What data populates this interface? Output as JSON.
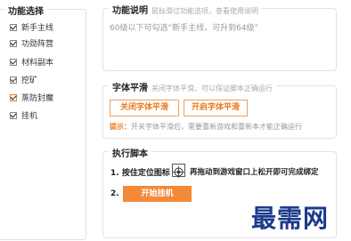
{
  "left_panel": {
    "title": "功能选择",
    "options": [
      {
        "label": "新手主线",
        "checked": true
      },
      {
        "label": "功勋阵营",
        "checked": true
      },
      {
        "label": "材料副本",
        "checked": true
      },
      {
        "label": "挖矿",
        "checked": true
      },
      {
        "label": "蒸防封魔",
        "checked": true
      },
      {
        "label": "挂机",
        "checked": true
      }
    ]
  },
  "feature_panel": {
    "title": "功能说明",
    "subtitle": "鼠标滑过功能选项，查看使用说明",
    "description": "60级以下可勾选“新手主线，可升到64级”"
  },
  "font_panel": {
    "title": "字体平滑",
    "subtitle": "关闭字体平滑，可以保证脚本正确运行",
    "close_button": "关闭字体平滑",
    "open_button": "开启字体平滑",
    "tip_label": "提示：",
    "tip_text": "开关字体平滑后，需要重新游戏和重新本才能正确运行"
  },
  "exec_panel": {
    "title": "执行脚本",
    "step1_prefix": "1. 按住定位图标",
    "step1_suffix": "再拖动到游戏窗口上松开即可完成绑定",
    "step2_label": "2.",
    "start_button": "开始挂机"
  },
  "watermark": "最需网",
  "colors": {
    "accent": "#f28a3a",
    "watermark": "#1c3a8c"
  }
}
